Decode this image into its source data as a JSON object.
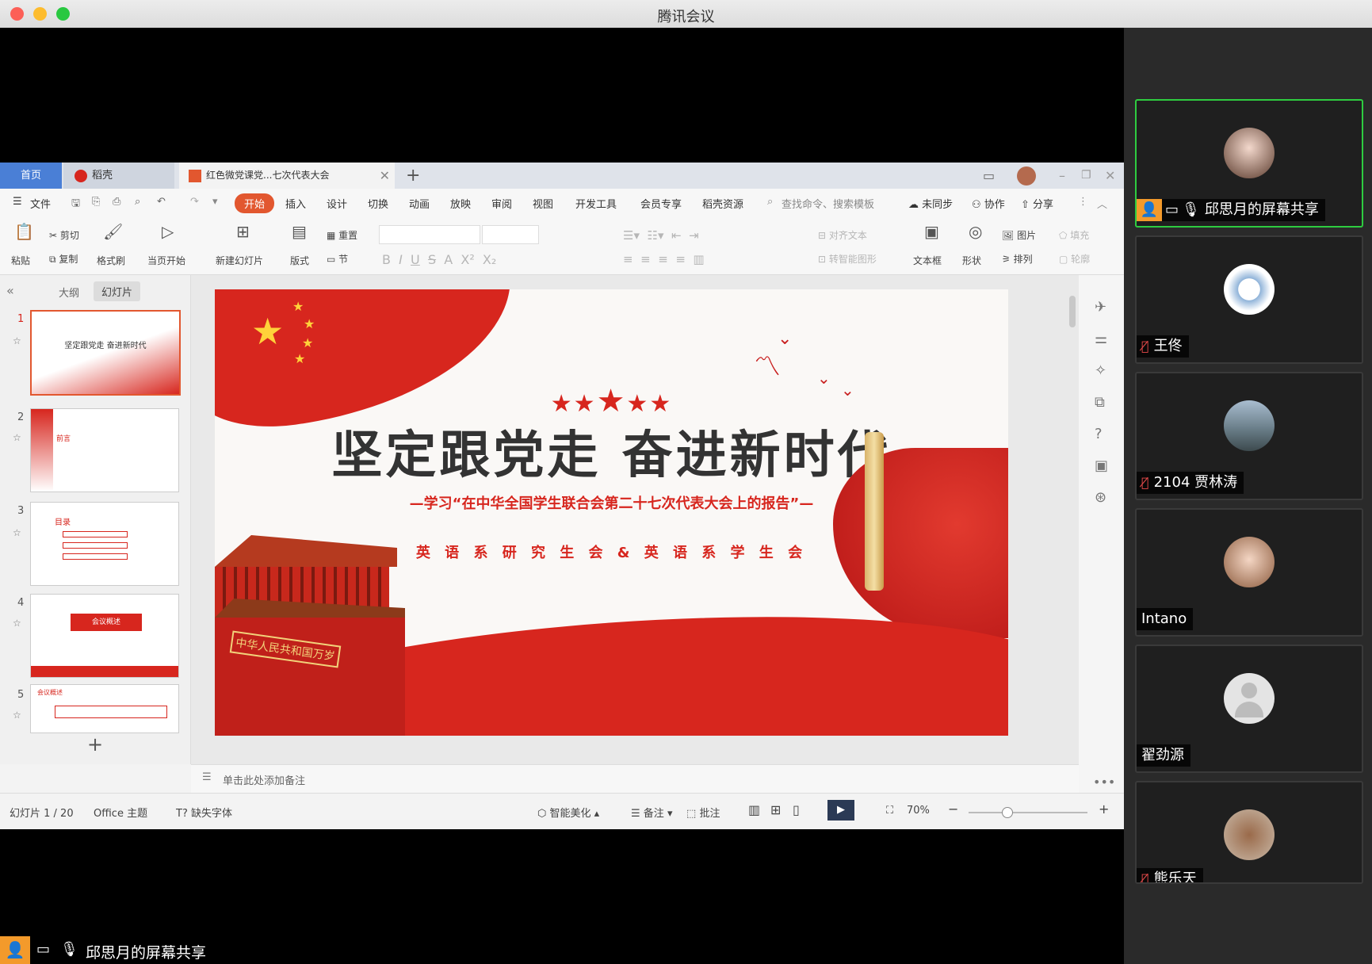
{
  "window": {
    "title": "腾讯会议"
  },
  "wps": {
    "tabs": {
      "home": "首页",
      "docer": "稻壳",
      "doc": "红色微党课党...七次代表大会"
    },
    "menu": {
      "file": "文件",
      "items": [
        "开始",
        "插入",
        "设计",
        "切换",
        "动画",
        "放映",
        "审阅",
        "视图",
        "开发工具",
        "会员专享",
        "稻壳资源"
      ],
      "search": "查找命令、搜索模板",
      "sync": "未同步",
      "collab": "协作",
      "share": "分享"
    },
    "ribbon": {
      "paste": "粘贴",
      "cut": "剪切",
      "copy": "复制",
      "format_painter": "格式刷",
      "from_current": "当页开始",
      "new_slide": "新建幻灯片",
      "layout": "版式",
      "reset": "重置",
      "section": "节",
      "align_text": "对齐文本",
      "convert_smartart": "转智能图形",
      "textbox": "文本框",
      "shape": "形状",
      "picture": "图片",
      "arrange": "排列",
      "fill": "填充",
      "outline": "轮廓"
    },
    "panel_tabs": {
      "outline": "大纲",
      "slides": "幻灯片"
    },
    "thumbnails": [
      {
        "num": "1",
        "title": "坚定跟党走  奋进新时代"
      },
      {
        "num": "2",
        "title": "前言"
      },
      {
        "num": "3",
        "title": "目录"
      },
      {
        "num": "4",
        "title": "会议概述"
      },
      {
        "num": "5",
        "title": "会议概述"
      }
    ],
    "slide": {
      "title": "坚定跟党走  奋进新时代",
      "subtitle": "—学习“在中华全国学生联合会第二十七次代表大会上的报告”—",
      "org": "英 语 系 研 究 生 会 & 英 语 系 学 生 会",
      "gate_sign": "中华人民共和国万岁"
    },
    "notes_placeholder": "单击此处添加备注",
    "status": {
      "slide_counter": "幻灯片 1 / 20",
      "theme": "Office 主题",
      "missing_font": "缺失字体",
      "beautify": "智能美化",
      "notes": "备注",
      "comment": "批注",
      "zoom": "70%"
    }
  },
  "participants": [
    {
      "name": "邱思月的屏幕共享",
      "active": true,
      "muted": false
    },
    {
      "name": "王佟",
      "muted": true
    },
    {
      "name": "2104 贾林涛",
      "muted": true
    },
    {
      "name": "Intano",
      "muted": false
    },
    {
      "name": "翟劲源",
      "muted": false
    },
    {
      "name": "熊乐天",
      "muted": true
    }
  ],
  "share_label": "邱思月的屏幕共享",
  "colors": {
    "accent_red": "#d7261e",
    "active_border": "#2ecc40",
    "wps_tab_blue": "#4a7fd6"
  }
}
